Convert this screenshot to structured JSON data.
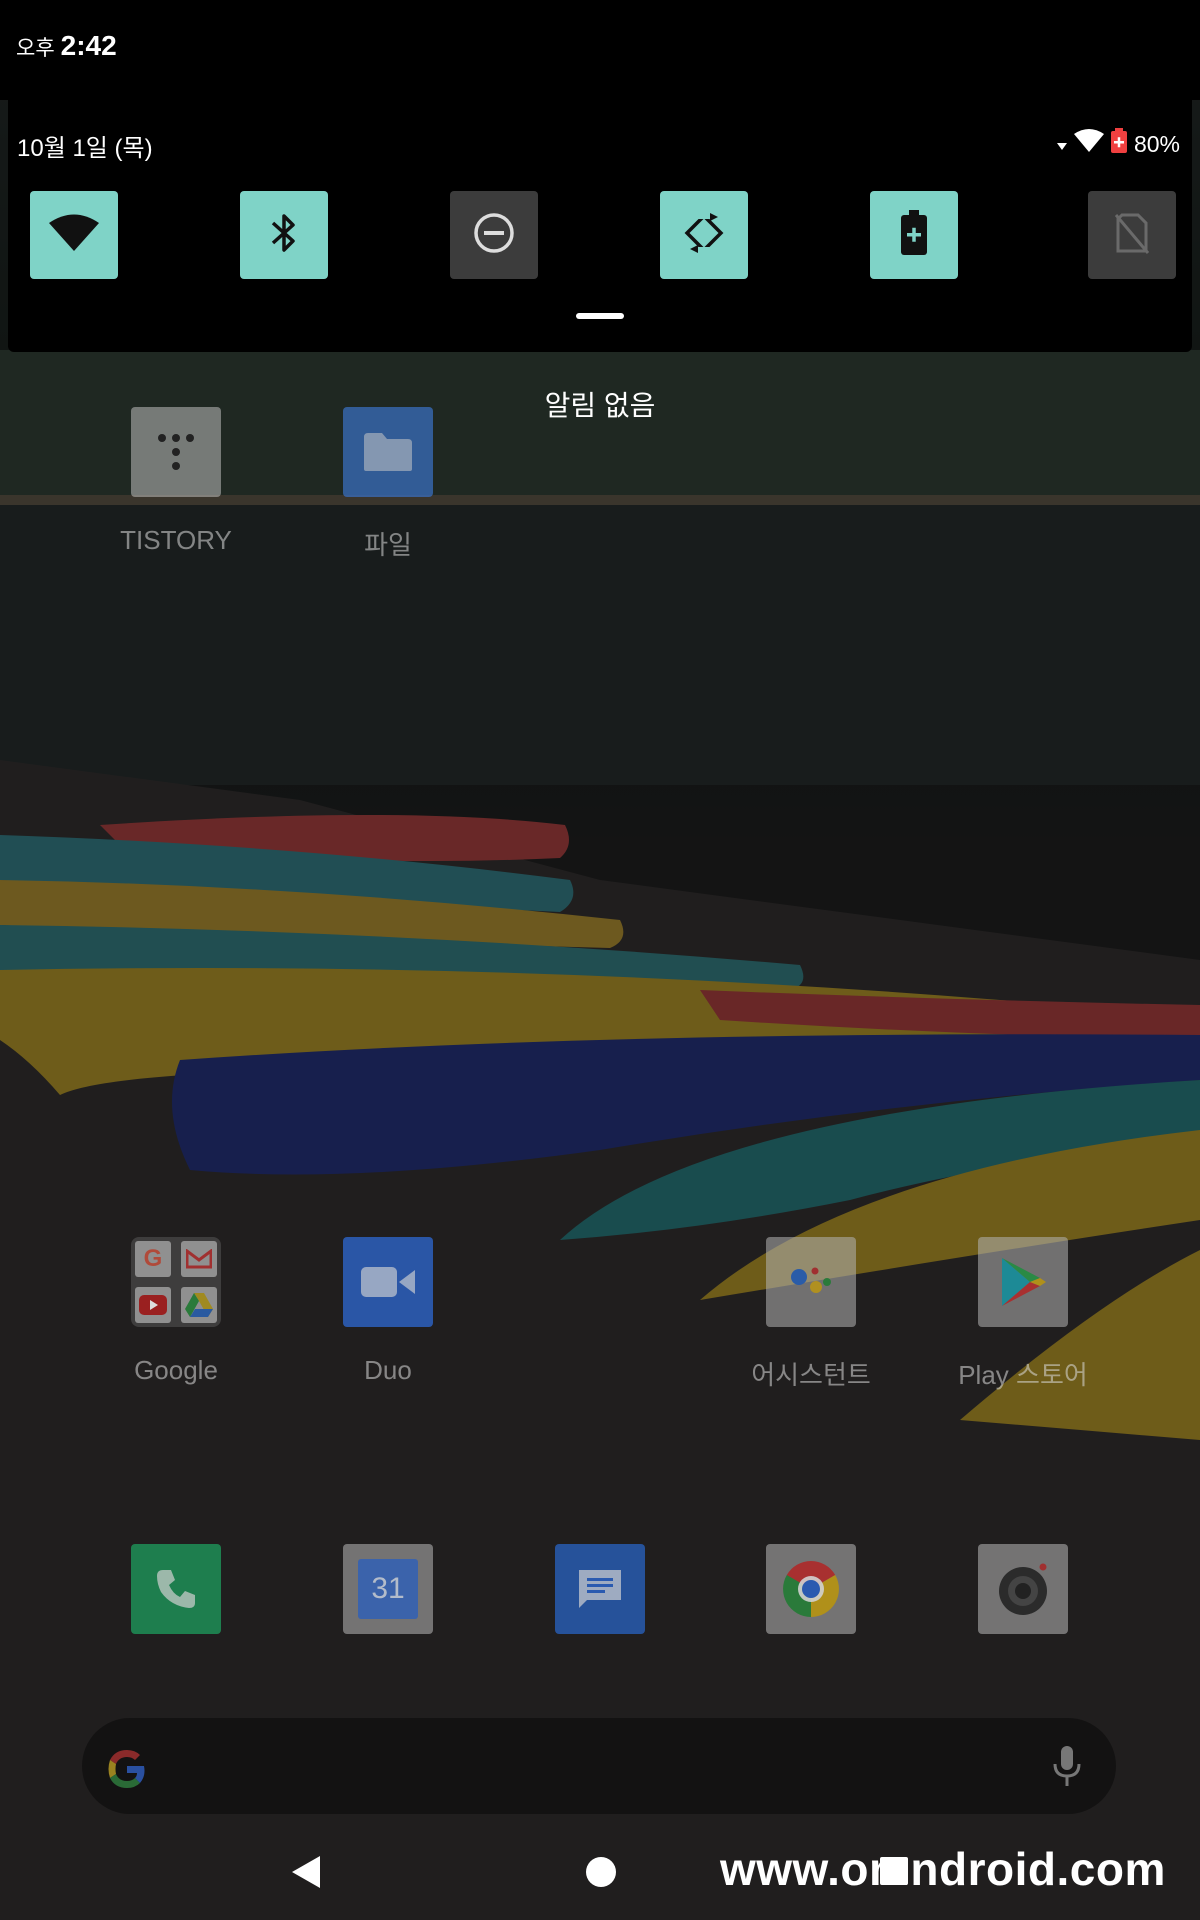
{
  "status_bar": {
    "ampm": "오후",
    "time": "2:42"
  },
  "quick_settings": {
    "date": "10월 1일 (목)",
    "battery_percent": "80%",
    "tiles": [
      {
        "name": "wifi",
        "icon": "wifi-icon",
        "state": "on"
      },
      {
        "name": "bluetooth",
        "icon": "bluetooth-icon",
        "state": "on"
      },
      {
        "name": "do-not-disturb",
        "icon": "do-not-disturb-icon",
        "state": "off"
      },
      {
        "name": "auto-rotate",
        "icon": "auto-rotate-icon",
        "state": "on"
      },
      {
        "name": "battery-saver",
        "icon": "battery-saver-icon",
        "state": "on"
      },
      {
        "name": "no-sim",
        "icon": "no-sim-icon",
        "state": "off"
      }
    ]
  },
  "notifications": {
    "empty_text": "알림 없음"
  },
  "home": {
    "row1": [
      {
        "label": "TISTORY",
        "icon": "tistory-icon"
      },
      {
        "label": "파일",
        "icon": "folder-icon"
      }
    ],
    "row2": [
      {
        "label": "Google",
        "icon": "google-folder-icon"
      },
      {
        "label": "Duo",
        "icon": "duo-icon"
      },
      {
        "label": "어시스턴트",
        "icon": "assistant-icon"
      },
      {
        "label": "Play 스토어",
        "icon": "play-store-icon"
      }
    ],
    "dock": [
      {
        "icon": "phone-icon"
      },
      {
        "icon": "calendar-icon",
        "text": "31"
      },
      {
        "icon": "messages-icon"
      },
      {
        "icon": "chrome-icon"
      },
      {
        "icon": "camera-icon"
      }
    ]
  },
  "watermark": "www.omndroid.com",
  "colors": {
    "tile_on": "#7fd3c7",
    "tile_off": "#3c3c3c"
  }
}
